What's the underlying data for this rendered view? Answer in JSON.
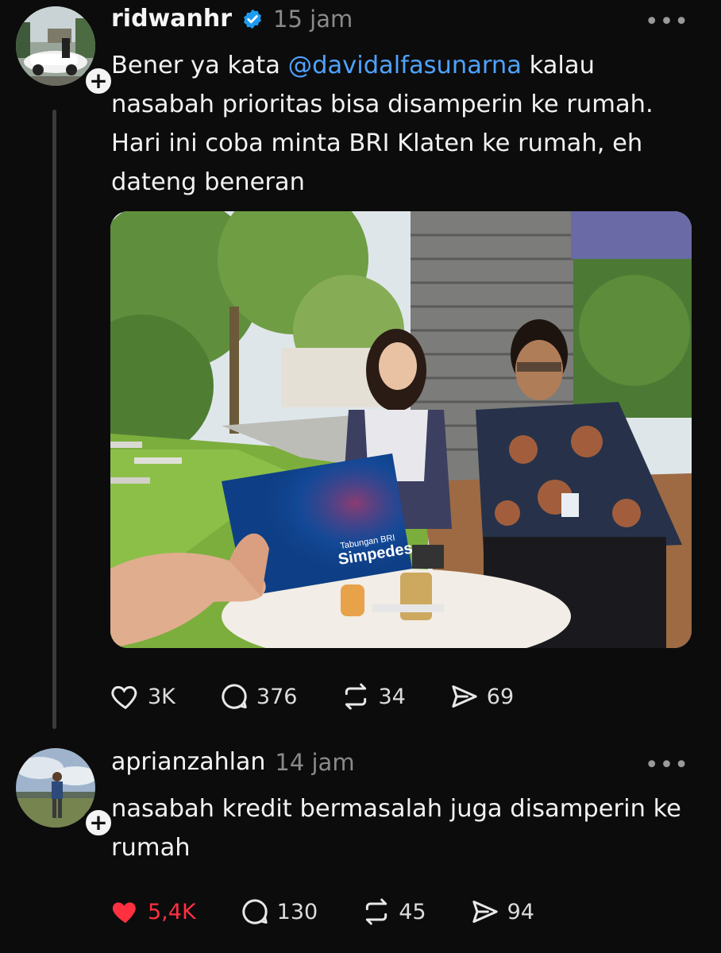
{
  "posts": [
    {
      "username": "ridwanhr",
      "time": "15 jam",
      "text_before": "Bener ya kata ",
      "mention": "@davidalfasunarna",
      "text_after": " kalau nasabah prioritas bisa disamperin ke rumah. Hari ini coba minta BRI Klaten ke rumah, eh dateng beneran",
      "verified": true,
      "photo": {
        "description_icon": "photo-icon",
        "card_brand_small": "Tabungan BRI",
        "card_brand": "Simpedes"
      },
      "stats": {
        "likes": "3K",
        "replies": "376",
        "reposts": "34",
        "shares": "69"
      },
      "liked": false
    },
    {
      "username": "aprianzahlan",
      "time": "14 jam",
      "text": "nasabah kredit bermasalah juga disamperin ke rumah",
      "stats": {
        "likes": "5,4K",
        "replies": "130",
        "reposts": "45",
        "shares": "94"
      },
      "liked": true
    }
  ],
  "more_label": "•••",
  "follow_label": "+",
  "colors": {
    "accent": "#4ea3ff",
    "like": "#ff3040",
    "verified": "#1d9bf0",
    "background": "#0c0c0c"
  }
}
